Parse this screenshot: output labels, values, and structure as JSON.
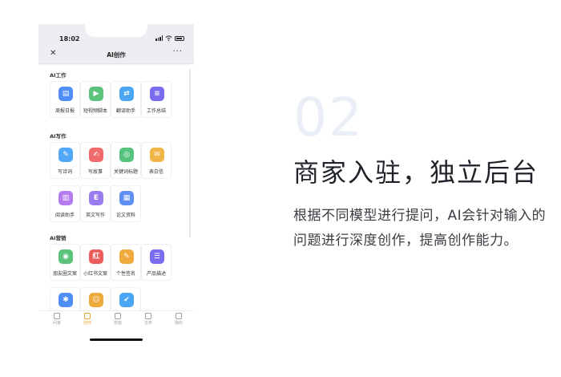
{
  "status_bar": {
    "time": "18:02"
  },
  "nav": {
    "close_icon": "close-icon",
    "title": "AI创作",
    "more_icon": "more-icon"
  },
  "sections": [
    {
      "title": "AI工作",
      "items": [
        {
          "label": "周报日报",
          "color": "#4f8df7",
          "icon": "document-icon"
        },
        {
          "label": "短视频脚本",
          "color": "#5cc47a",
          "icon": "play-icon"
        },
        {
          "label": "翻译助手",
          "color": "#4aa5f5",
          "icon": "translate-icon"
        },
        {
          "label": "工作总结",
          "color": "#7a6cf0",
          "icon": "report-icon"
        }
      ]
    },
    {
      "title": "AI写作",
      "items": [
        {
          "label": "写诗词",
          "color": "#52a8f6",
          "icon": "brush-icon"
        },
        {
          "label": "写故事",
          "color": "#f06b6b",
          "icon": "story-icon"
        },
        {
          "label": "关键词标题",
          "color": "#58c27f",
          "icon": "search-icon"
        },
        {
          "label": "表白信",
          "color": "#f0b64a",
          "icon": "letter-icon"
        },
        {
          "label": "阅读助手",
          "color": "#b57cf0",
          "icon": "book-icon"
        },
        {
          "label": "英文写作",
          "color": "#9b7cf0",
          "icon": "english-icon"
        },
        {
          "label": "论文资料",
          "color": "#5f8ff2",
          "icon": "paper-icon"
        }
      ]
    },
    {
      "title": "AI营销",
      "items": [
        {
          "label": "朋友圈文案",
          "color": "#5cc47a",
          "icon": "moments-icon"
        },
        {
          "label": "小红书文案",
          "color": "#ee5b5b",
          "icon": "xiaohongshu-icon"
        },
        {
          "label": "个性签名",
          "color": "#f0a93c",
          "icon": "pen-icon"
        },
        {
          "label": "产品描述",
          "color": "#7a6cf0",
          "icon": "list-icon"
        },
        {
          "label": "",
          "color": "#4f8df7",
          "icon": "idea-icon"
        },
        {
          "label": "",
          "color": "#f0a93c",
          "icon": "robot-icon"
        },
        {
          "label": "",
          "color": "#4aa5f5",
          "icon": "thumbs-up-icon"
        }
      ]
    }
  ],
  "tabbar": [
    {
      "label": "问答",
      "icon": "chat-icon",
      "active": false
    },
    {
      "label": "创作",
      "icon": "create-icon",
      "active": true
    },
    {
      "label": "技能",
      "icon": "skills-icon",
      "active": false
    },
    {
      "label": "任务",
      "icon": "task-icon",
      "active": false
    },
    {
      "label": "我的",
      "icon": "user-icon",
      "active": false
    }
  ],
  "feature": {
    "number": "02",
    "heading": "商家入驻，独立后台",
    "description": "根据不同模型进行提问，AI会针对输入的问题进行深度创作，提高创作能力。"
  }
}
